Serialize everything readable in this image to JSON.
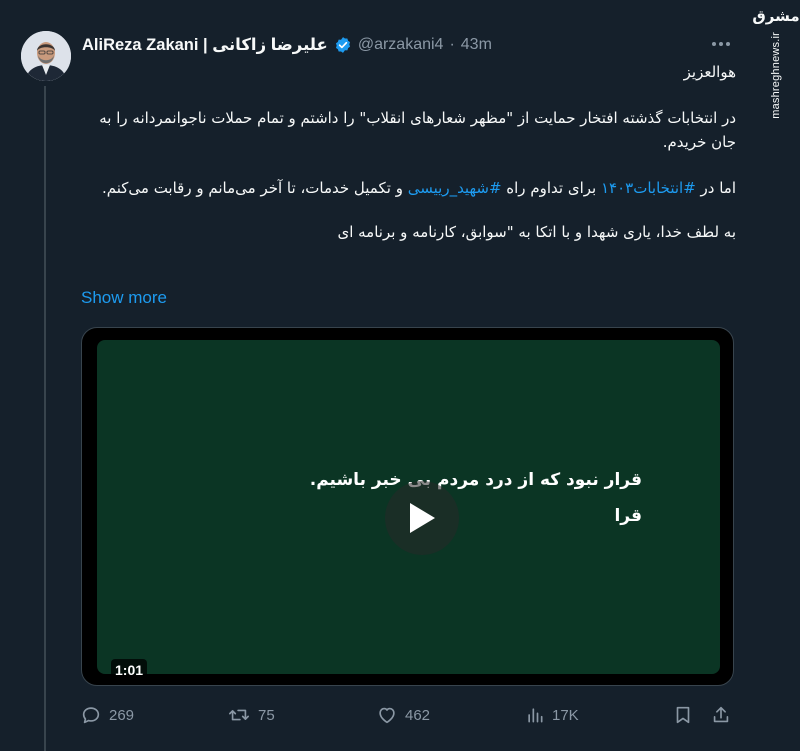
{
  "tweet": {
    "author_name": "AliReza Zakani | علیرضا زاکانی",
    "handle": "@arzakani4",
    "separator": "·",
    "time": "43m",
    "body": {
      "line1": "هوالعزیز",
      "para2": "در انتخابات گذشته افتخار حمایت از \"مظهر شعارهای انقلاب\" را داشتم و تمام حملات ناجوانمردانه را به جان خریدم.",
      "para3_before": "اما در ",
      "para3_hashtag1": "#انتخابات۱۴۰۳",
      "para3_mid": " برای تداوم راه ",
      "para3_hashtag2": "#شهید_رییسی",
      "para3_after": " و تکمیل خدمات، تا آخر می‌مانم و رقابت می‌کنم.",
      "para4": "به لطف خدا، یاری شهدا و با اتکا به \"سوابق، کارنامه و برنامه ای"
    },
    "show_more": "Show more",
    "video": {
      "caption_line1": "قرار نبود که از درد مردم بی خبر باشیم.",
      "caption_line2": "قرا",
      "duration": "1:01"
    },
    "actions": {
      "replies": "269",
      "retweets": "75",
      "likes": "462",
      "views": "17K"
    }
  },
  "watermark": {
    "logo": "مشرق",
    "url": "mashreghnews.ir"
  },
  "colors": {
    "background": "#15202b",
    "text": "#f7f9f9",
    "secondary": "#8b98a5",
    "accent": "#1d9bf0",
    "video_bg": "#0b3524"
  },
  "icons": [
    "verified-badge-icon",
    "more-icon",
    "play-icon",
    "reply-icon",
    "retweet-icon",
    "like-icon",
    "views-icon",
    "bookmark-icon",
    "share-icon"
  ]
}
